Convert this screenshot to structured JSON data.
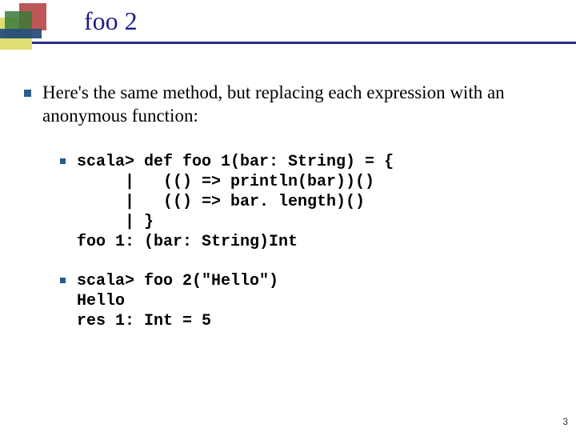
{
  "title": "foo 2",
  "intro": "Here's the same method, but replacing each expression with an anonymous function:",
  "code_block_1": "scala> def foo 1(bar: String) = {\n     |   (() => println(bar))()\n     |   (() => bar. length)()\n     | }\nfoo 1: (bar: String)Int",
  "code_block_2": "scala> foo 2(\"Hello\")\nHello\nres 1: Int = 5",
  "page_number": "3"
}
